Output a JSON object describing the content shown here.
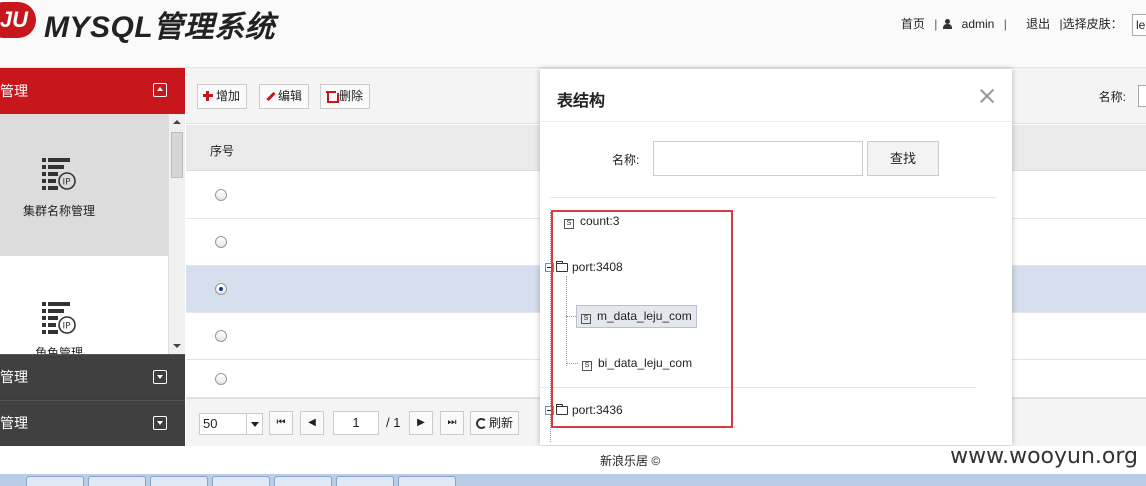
{
  "header": {
    "logo_badge": "JU",
    "title": "MYSQL管理系统",
    "nav": {
      "home": "首页",
      "separator": "|",
      "user": "admin",
      "logout": "退出",
      "skin_label": "|选择皮肤：",
      "skin_value": "le"
    }
  },
  "sidebar": {
    "active_group": "管理",
    "tiles": [
      {
        "label": "集群名称管理",
        "icon": "server-ip-icon"
      },
      {
        "label": "角色管理",
        "icon": "server-ip-icon"
      }
    ],
    "groups": [
      {
        "label": "管理"
      },
      {
        "label": "管理"
      }
    ]
  },
  "toolbar": {
    "add": "增加",
    "edit": "编辑",
    "delete": "删除",
    "name_label": "名称:"
  },
  "grid": {
    "columns": [
      "序号"
    ],
    "rows": [
      {
        "selected": false
      },
      {
        "selected": false
      },
      {
        "selected": true
      },
      {
        "selected": false
      },
      {
        "selected": false
      }
    ]
  },
  "pager": {
    "page_size": "50",
    "current_page": "1",
    "total_pages": "/ 1",
    "refresh": "刷新"
  },
  "modal": {
    "title": "表结构",
    "name_label": "名称:",
    "search_button": "查找",
    "search_value": "",
    "tree": [
      {
        "label": "count:3",
        "type": "leaf"
      },
      {
        "label": "port:3408",
        "type": "folder",
        "children": [
          {
            "label": "m_data_leju_com",
            "selected": true
          },
          {
            "label": "bi_data_leju_com",
            "selected": false
          }
        ]
      },
      {
        "label": "port:3436",
        "type": "folder"
      }
    ]
  },
  "footer": {
    "copyright": "新浪乐居 ©",
    "watermark": "www.wooyun.org"
  },
  "colors": {
    "brand_red": "#c8161d",
    "selected_row": "#d5dfed",
    "sidebar_dark": "#404040",
    "annotation_red": "#d73b3b"
  }
}
